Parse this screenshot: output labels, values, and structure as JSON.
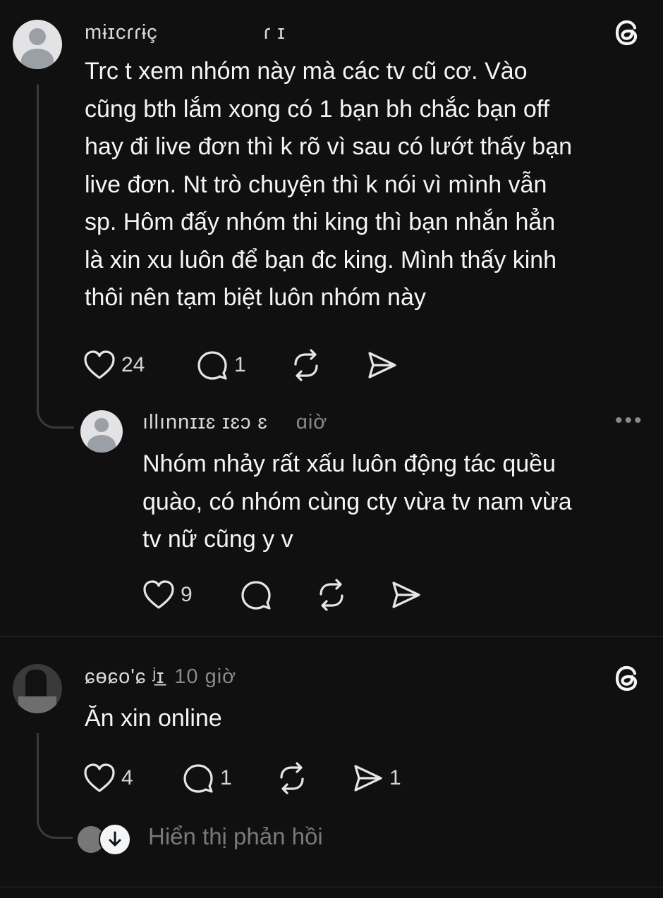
{
  "post1": {
    "username": "mɨɪcɾɾɨç",
    "username_tail": "ɾ ɪ",
    "lines": [
      "Trc t xem nhóm này mà các tv cũ cơ. Vào",
      "cũng bth lắm xong có 1 bạn bh chắc bạn off",
      "hay đi live đơn thì k rõ vì sau có lướt thấy bạn",
      "live đơn. Nt trò chuyện thì k nói vì mình vẫn",
      "sp. Hôm đấy nhóm thi king thì bạn nhắn hẳn",
      "là xin xu luôn để bạn đc king. Mình thấy kinh",
      "thôi nên tạm biệt luôn nhóm này"
    ],
    "likes": "24",
    "replies": "1"
  },
  "reply1": {
    "username": "ıllınnɪɪɛ ɪɛɔ ɛ",
    "time": "ɑiờ",
    "more": "•••",
    "lines": [
      "Nhóm nhảy rất xấu luôn động tác quều",
      "quào, có nhóm cùng cty vừa tv nam vừa",
      "tv nữ cũng y v"
    ],
    "likes": "9"
  },
  "post2": {
    "username": "ɕɵɕo'ɕ ʲɪ̲",
    "time": "10 giờ",
    "text": "Ăn xin online",
    "likes": "4",
    "replies": "1",
    "shares": "1",
    "show_replies": "Hiển thị phản hồi"
  },
  "icons": {
    "like": "heart-icon",
    "reply": "comment-icon",
    "repost": "repost-icon",
    "share": "send-icon",
    "logo": "threads-logo-icon"
  }
}
